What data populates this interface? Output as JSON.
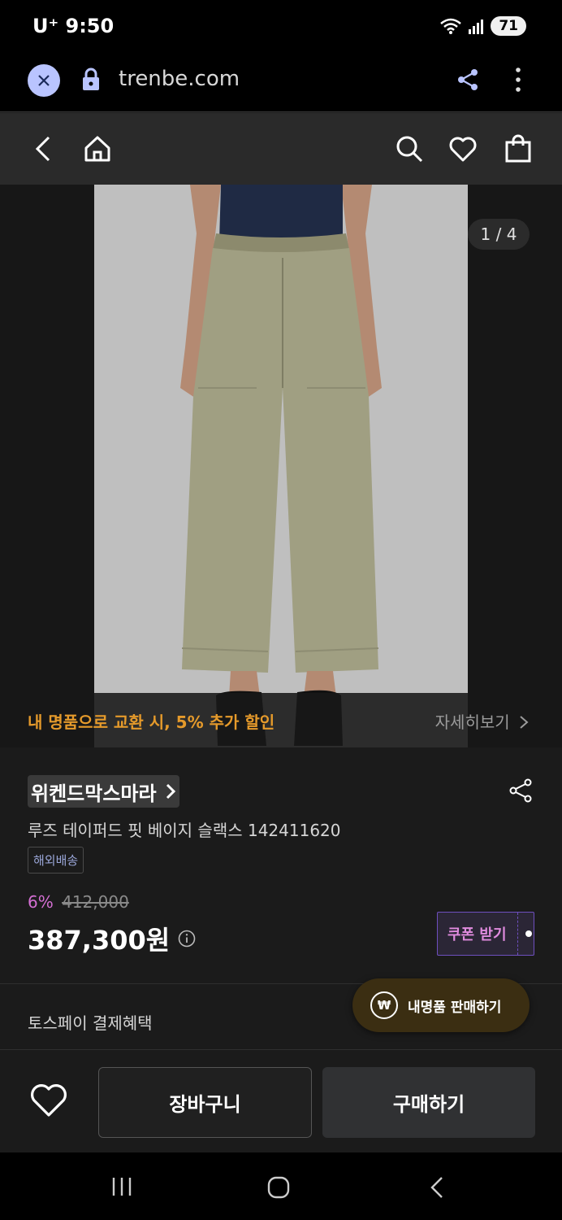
{
  "status_bar": {
    "carrier": "U⁺ 9:50",
    "battery": "71"
  },
  "browser": {
    "url": "trenbe.com"
  },
  "gallery": {
    "counter": "1 / 4",
    "promo_text": "내 명품으로 교환 시, 5% 추가 할인",
    "promo_link": "자세히보기"
  },
  "product": {
    "brand": "위켄드막스마라",
    "name": "루즈 테이퍼드 핏 베이지 슬랙스 142411620",
    "shipping_badge": "해외배송",
    "discount_rate": "6%",
    "original_price": "412,000",
    "price": "387,300원",
    "coupon_label": "쿠폰 받기"
  },
  "benefits": {
    "toss_label": "토스페이 결제혜택",
    "sell_label": "내명품 판매하기",
    "sell_icon": "₩"
  },
  "actions": {
    "cart_label": "장바구니",
    "buy_label": "구매하기"
  },
  "colors": {
    "promo": "#e59a2b",
    "discount": "#d46fd3",
    "coupon_border": "#6e4fbf"
  }
}
